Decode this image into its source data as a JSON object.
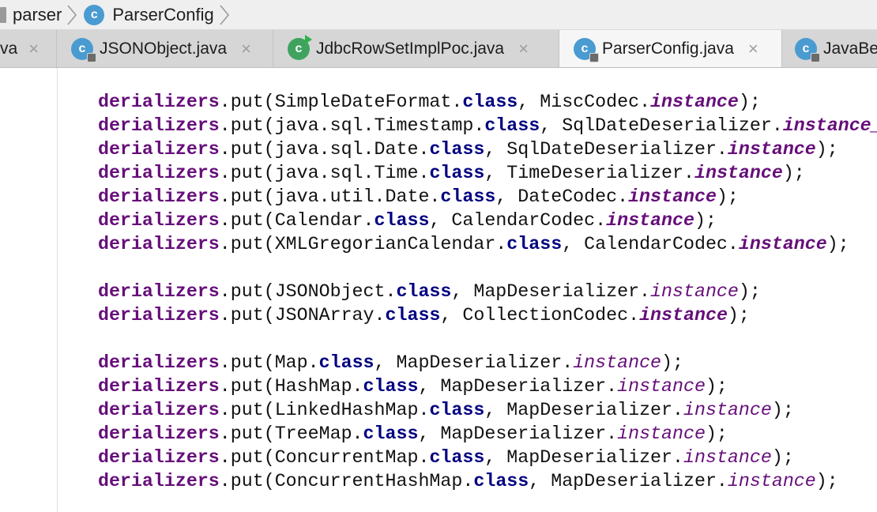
{
  "breadcrumb": {
    "items": [
      {
        "label": "parser",
        "icon": "folder-icon"
      },
      {
        "label": "ParserConfig",
        "icon": "class-icon"
      }
    ],
    "class_icon_letter": "c"
  },
  "tabs": [
    {
      "label": "va",
      "icon": null,
      "active": false,
      "close": "×"
    },
    {
      "label": "JSONObject.java",
      "icon": "class-icon",
      "active": false,
      "close": "×"
    },
    {
      "label": "JdbcRowSetImplPoc.java",
      "icon": "runnable-class-icon",
      "active": false,
      "close": "×"
    },
    {
      "label": "ParserConfig.java",
      "icon": "class-icon",
      "active": true,
      "close": "×"
    },
    {
      "label": "JavaBe",
      "icon": "class-icon",
      "active": false,
      "close": ""
    }
  ],
  "editor": {
    "lines": [
      {
        "field": "derializers",
        "mid": ".put(SimpleDateFormat.",
        "kw": "class",
        "arg": ", MiscCodec.",
        "inst": "instance",
        "inst_bold": true,
        "tail": ");"
      },
      {
        "field": "derializers",
        "mid": ".put(java.sql.Timestamp.",
        "kw": "class",
        "arg": ", SqlDateDeserializer.",
        "inst": "instance_",
        "inst_bold": true,
        "tail": ""
      },
      {
        "field": "derializers",
        "mid": ".put(java.sql.Date.",
        "kw": "class",
        "arg": ", SqlDateDeserializer.",
        "inst": "instance",
        "inst_bold": true,
        "tail": ");"
      },
      {
        "field": "derializers",
        "mid": ".put(java.sql.Time.",
        "kw": "class",
        "arg": ", TimeDeserializer.",
        "inst": "instance",
        "inst_bold": true,
        "tail": ");"
      },
      {
        "field": "derializers",
        "mid": ".put(java.util.Date.",
        "kw": "class",
        "arg": ", DateCodec.",
        "inst": "instance",
        "inst_bold": true,
        "tail": ");"
      },
      {
        "field": "derializers",
        "mid": ".put(Calendar.",
        "kw": "class",
        "arg": ", CalendarCodec.",
        "inst": "instance",
        "inst_bold": true,
        "tail": ");"
      },
      {
        "field": "derializers",
        "mid": ".put(XMLGregorianCalendar.",
        "kw": "class",
        "arg": ", CalendarCodec.",
        "inst": "instance",
        "inst_bold": true,
        "tail": ");"
      },
      {
        "blank": true
      },
      {
        "field": "derializers",
        "mid": ".put(JSONObject.",
        "kw": "class",
        "arg": ", MapDeserializer.",
        "inst": "instance",
        "inst_bold": false,
        "tail": ");"
      },
      {
        "field": "derializers",
        "mid": ".put(JSONArray.",
        "kw": "class",
        "arg": ", CollectionCodec.",
        "inst": "instance",
        "inst_bold": true,
        "tail": ");"
      },
      {
        "blank": true
      },
      {
        "field": "derializers",
        "mid": ".put(Map.",
        "kw": "class",
        "arg": ", MapDeserializer.",
        "inst": "instance",
        "inst_bold": false,
        "tail": ");"
      },
      {
        "field": "derializers",
        "mid": ".put(HashMap.",
        "kw": "class",
        "arg": ", MapDeserializer.",
        "inst": "instance",
        "inst_bold": false,
        "tail": ");"
      },
      {
        "field": "derializers",
        "mid": ".put(LinkedHashMap.",
        "kw": "class",
        "arg": ", MapDeserializer.",
        "inst": "instance",
        "inst_bold": false,
        "tail": ");"
      },
      {
        "field": "derializers",
        "mid": ".put(TreeMap.",
        "kw": "class",
        "arg": ", MapDeserializer.",
        "inst": "instance",
        "inst_bold": false,
        "tail": ");"
      },
      {
        "field": "derializers",
        "mid": ".put(ConcurrentMap.",
        "kw": "class",
        "arg": ", MapDeserializer.",
        "inst": "instance",
        "inst_bold": false,
        "tail": ");"
      },
      {
        "field": "derializers",
        "mid": ".put(ConcurrentHashMap.",
        "kw": "class",
        "arg": ", MapDeserializer.",
        "inst": "instance",
        "inst_bold": false,
        "tail": ");"
      }
    ]
  },
  "colors": {
    "field": "#660e7a",
    "keyword": "#000080",
    "class_icon": "#4a9bd1"
  }
}
